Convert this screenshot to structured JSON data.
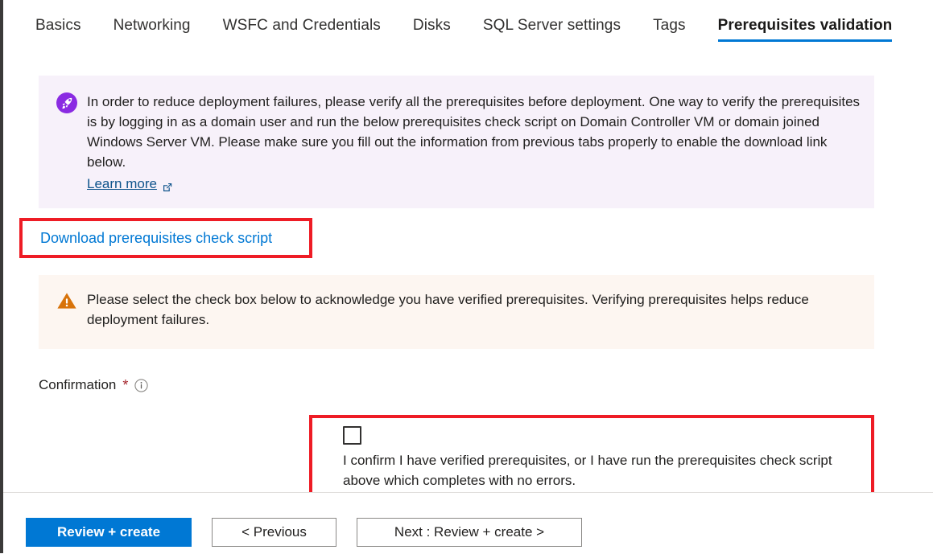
{
  "tabs": [
    {
      "label": "Basics",
      "active": false
    },
    {
      "label": "Networking",
      "active": false
    },
    {
      "label": "WSFC and Credentials",
      "active": false
    },
    {
      "label": "Disks",
      "active": false
    },
    {
      "label": "SQL Server settings",
      "active": false
    },
    {
      "label": "Tags",
      "active": false
    },
    {
      "label": "Prerequisites validation",
      "active": true
    }
  ],
  "info_banner": {
    "icon": "rocket-icon",
    "icon_color": "#8a2be2",
    "background": "#f7f1fa",
    "text": "In order to reduce deployment failures, please verify all the prerequisites before deployment. One way to verify the prerequisites is by logging in as a domain user and run the below prerequisites check script on Domain Controller VM or domain joined Windows Server VM. Please make sure you fill out the information from previous tabs properly to enable the download link below.",
    "learn_more_label": "Learn more",
    "learn_more_icon": "external-link-icon"
  },
  "download": {
    "link_label": "Download prerequisites check script",
    "link_color": "#0078d4",
    "highlight_color": "#ee1c25"
  },
  "warning_banner": {
    "icon": "warning-triangle-icon",
    "icon_color": "#d8730a",
    "background": "#fdf6f1",
    "text": "Please select the check box below to acknowledge you have verified prerequisites. Verifying prerequisites helps reduce deployment failures."
  },
  "confirmation": {
    "label": "Confirmation",
    "required_marker": "*",
    "required_color": "#a4262c",
    "info_icon": "info-circle-icon",
    "checkbox_checked": false,
    "checkbox_label": "I confirm I have verified prerequisites, or I have run the prerequisites check script above which completes with no errors.",
    "highlight_color": "#ee1c25"
  },
  "footer": {
    "review_create_label": "Review + create",
    "previous_label": "< Previous",
    "next_label": "Next : Review + create >",
    "primary_color": "#0078d4"
  }
}
